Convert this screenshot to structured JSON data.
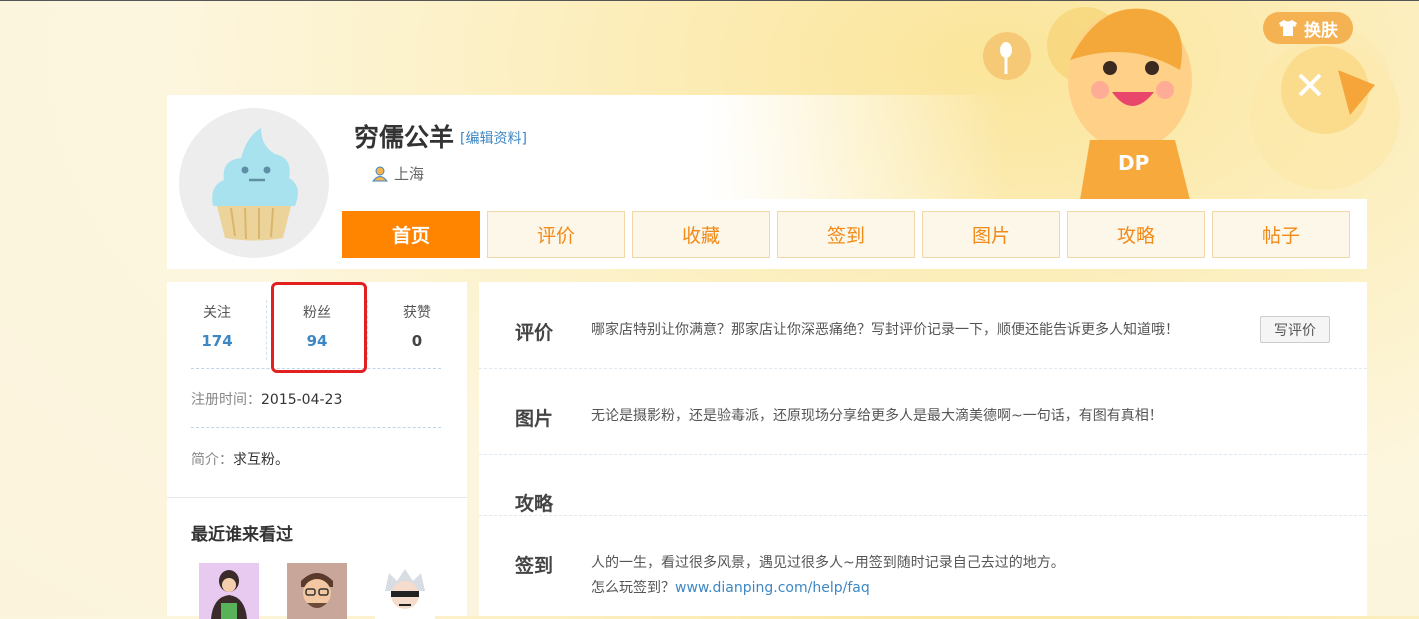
{
  "skin_button": {
    "label": "换肤",
    "icon": "tshirt-icon"
  },
  "profile": {
    "username": "穷儒公羊",
    "edit_link": "[编辑资料]",
    "location": "上海",
    "location_icon": "user-location-icon",
    "avatar_icon": "cupcake-icon"
  },
  "tabs": [
    {
      "label": "首页",
      "active": true
    },
    {
      "label": "评价",
      "active": false
    },
    {
      "label": "收藏",
      "active": false
    },
    {
      "label": "签到",
      "active": false
    },
    {
      "label": "图片",
      "active": false
    },
    {
      "label": "攻略",
      "active": false
    },
    {
      "label": "帖子",
      "active": false
    }
  ],
  "stats": {
    "following": {
      "label": "关注",
      "value": "174"
    },
    "fans": {
      "label": "粉丝",
      "value": "94"
    },
    "likes": {
      "label": "获赞",
      "value": "0"
    }
  },
  "registered": {
    "label": "注册时间：",
    "value": "2015-04-23"
  },
  "intro": {
    "label": "简介：",
    "value": "求互粉。"
  },
  "recent_visitors": {
    "title": "最近谁来看过"
  },
  "sections": {
    "review": {
      "title": "评价",
      "desc": "哪家店特别让你满意？那家店让你深恶痛绝？写封评价记录一下，顺便还能告诉更多人知道哦！",
      "button": "写评价"
    },
    "photo": {
      "title": "图片",
      "desc": "无论是摄影粉，还是验毒派，还原现场分享给更多人是最大滴美德啊~一句话，有图有真相！"
    },
    "guide": {
      "title": "攻略"
    },
    "checkin": {
      "title": "签到",
      "desc": "人的一生，看过很多风景，遇见过很多人~用签到随时记录自己去过的地方。",
      "faq_prefix": "怎么玩签到？",
      "faq_link": "www.dianping.com/help/faq"
    }
  },
  "colors": {
    "accent": "#ff8400",
    "link": "#3d87c4",
    "highlight": "#e32020"
  }
}
